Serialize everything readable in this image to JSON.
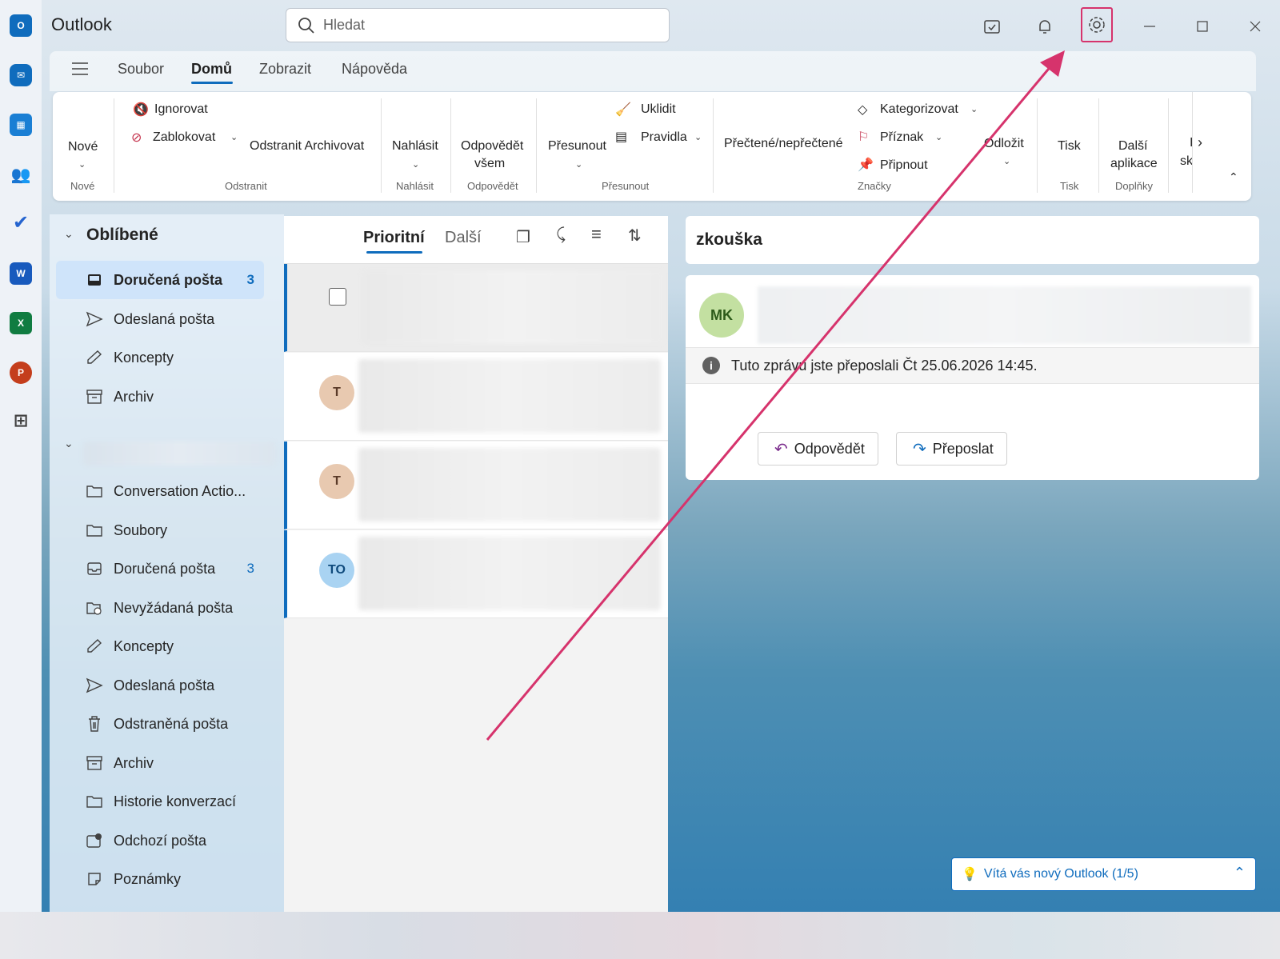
{
  "app": {
    "title": "Outlook"
  },
  "search": {
    "placeholder": "Hledat"
  },
  "tabs": [
    {
      "label": "Soubor"
    },
    {
      "label": "Domů"
    },
    {
      "label": "Zobrazit"
    },
    {
      "label": "Nápověda"
    }
  ],
  "ribbon": {
    "new_label": "Nové",
    "new_group": "Nové",
    "ignore": "Ignorovat",
    "block": "Zablokovat",
    "delete_archive": "Odstranit Archivovat",
    "delete_group": "Odstranit",
    "report": "Nahlásit",
    "report_group": "Nahlásit",
    "reply_all_line1": "Odpovědět",
    "reply_all_line2": "všem",
    "reply_group": "Odpovědět",
    "move": "Přesunout",
    "sweep": "Uklidit",
    "rules": "Pravidla",
    "move_group": "Přesunout",
    "read_unread": "Přečtené/nepřečtené",
    "categorize": "Kategorizovat",
    "flag": "Příznak",
    "pin": "Připnout",
    "tags_group": "Značky",
    "snooze": "Odložit",
    "print": "Tisk",
    "print_group": "Tisk",
    "more_apps_line1": "Další",
    "more_apps_line2": "aplikace",
    "addins_group": "Doplňky",
    "cut_off_1": "I",
    "cut_off_2": "sk"
  },
  "folders": {
    "favorites_header": "Oblíbené",
    "favorites": [
      {
        "label": "Doručená pošta",
        "count": "3",
        "icon": "inbox-icon"
      },
      {
        "label": "Odeslaná pošta",
        "count": "",
        "icon": "send-icon"
      },
      {
        "label": "Koncepty",
        "count": "",
        "icon": "draft-icon"
      },
      {
        "label": "Archiv",
        "count": "",
        "icon": "archive-icon"
      }
    ],
    "account": [
      {
        "label": "Conversation Actio...",
        "count": "",
        "icon": "folder-icon"
      },
      {
        "label": "Soubory",
        "count": "",
        "icon": "folder-icon"
      },
      {
        "label": "Doručená pošta",
        "count": "3",
        "icon": "inbox-icon"
      },
      {
        "label": "Nevyžádaná pošta",
        "count": "",
        "icon": "junk-icon"
      },
      {
        "label": "Koncepty",
        "count": "",
        "icon": "draft-icon"
      },
      {
        "label": "Odeslaná pošta",
        "count": "",
        "icon": "send-icon"
      },
      {
        "label": "Odstraněná pošta",
        "count": "",
        "icon": "trash-icon"
      },
      {
        "label": "Archiv",
        "count": "",
        "icon": "archive-icon"
      },
      {
        "label": "Historie konverzací",
        "count": "",
        "icon": "folder-icon"
      },
      {
        "label": "Odchozí pošta",
        "count": "",
        "icon": "outbox-icon"
      },
      {
        "label": "Poznámky",
        "count": "",
        "icon": "note-icon"
      }
    ]
  },
  "message_list": {
    "tab_focused": "Prioritní",
    "tab_other": "Další",
    "avatars": [
      "T",
      "T",
      "TO"
    ]
  },
  "reading": {
    "subject": "zkouška",
    "sender_initials": "MK",
    "info": "Tuto zprávu jste přeposlali Čt 25.06.2026 14:45.",
    "reply": "Odpovědět",
    "forward": "Přeposlat"
  },
  "welcome": {
    "label": "Vítá vás nový Outlook  (1/5)"
  },
  "colors": {
    "accent": "#0f6cbd",
    "annotation": "#d6336c"
  }
}
